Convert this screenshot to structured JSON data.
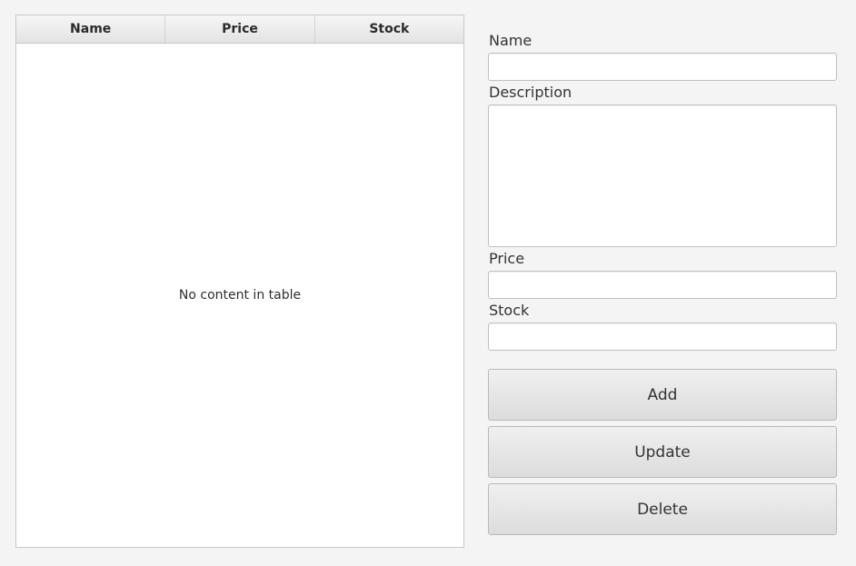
{
  "table": {
    "columns": [
      "Name",
      "Price",
      "Stock"
    ],
    "rows": [],
    "empty_message": "No content in table"
  },
  "form": {
    "name_label": "Name",
    "name_value": "",
    "description_label": "Description",
    "description_value": "",
    "price_label": "Price",
    "price_value": "",
    "stock_label": "Stock",
    "stock_value": ""
  },
  "buttons": {
    "add": "Add",
    "update": "Update",
    "delete": "Delete"
  }
}
